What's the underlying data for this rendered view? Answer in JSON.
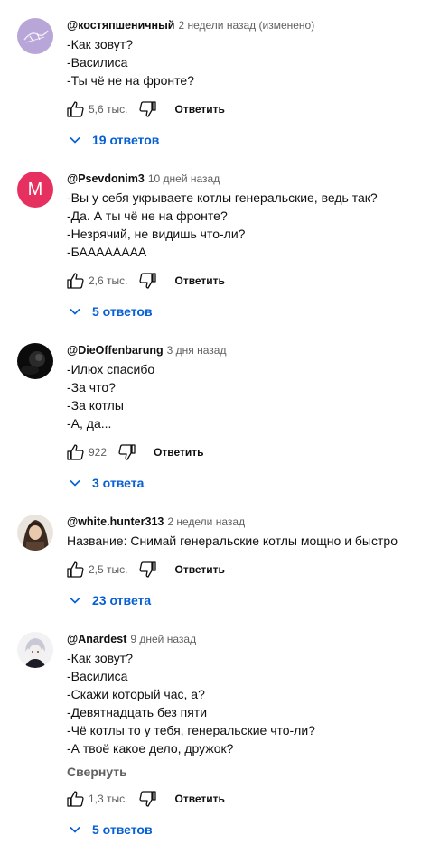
{
  "comments": [
    {
      "author": "@костяпшеничный",
      "time": "2 недели назад (изменено)",
      "lines": [
        "-Как зовут?",
        "-Василиса",
        "-Ты чё не на фронте?"
      ],
      "likes": "5,6 тыс.",
      "reply_label": "Ответить",
      "replies_label": "19 ответов"
    },
    {
      "author": "@Psevdonim3",
      "time": "10 дней назад",
      "avatar_letter": "M",
      "avatar_color": "#e6305f",
      "lines": [
        "-Вы у себя укрываете котлы генеральские, ведь так?",
        "-Да. А ты чё не на фронте?",
        "-Незрячий, не видишь что-ли?",
        "-БАААААААА"
      ],
      "likes": "2,6 тыс.",
      "reply_label": "Ответить",
      "replies_label": "5 ответов"
    },
    {
      "author": "@DieOffenbarung",
      "time": "3 дня назад",
      "lines": [
        "-Илюх спасибо",
        "-За что?",
        "-За котлы",
        "-А, да..."
      ],
      "likes": "922",
      "reply_label": "Ответить",
      "replies_label": "3 ответа"
    },
    {
      "author": "@white.hunter313",
      "time": "2 недели назад",
      "lines": [
        "Название: Снимай генеральские котлы мощно и быстро"
      ],
      "likes": "2,5 тыс.",
      "reply_label": "Ответить",
      "replies_label": "23 ответа"
    },
    {
      "author": "@Anardest",
      "time": "9 дней назад",
      "lines": [
        "-Как зовут?",
        "-Василиса",
        "-Скажи который час, а?",
        "-Девятнадцать без пяти",
        "-Чё котлы то у тебя, генеральские что-ли?",
        "-А твоё какое дело, дружок?"
      ],
      "collapse_label": "Свернуть",
      "likes": "1,3 тыс.",
      "reply_label": "Ответить",
      "replies_label": "5 ответов"
    }
  ],
  "colors": {
    "link_blue": "#065fd4",
    "meta_gray": "#606060",
    "text": "#0f0f0f"
  }
}
